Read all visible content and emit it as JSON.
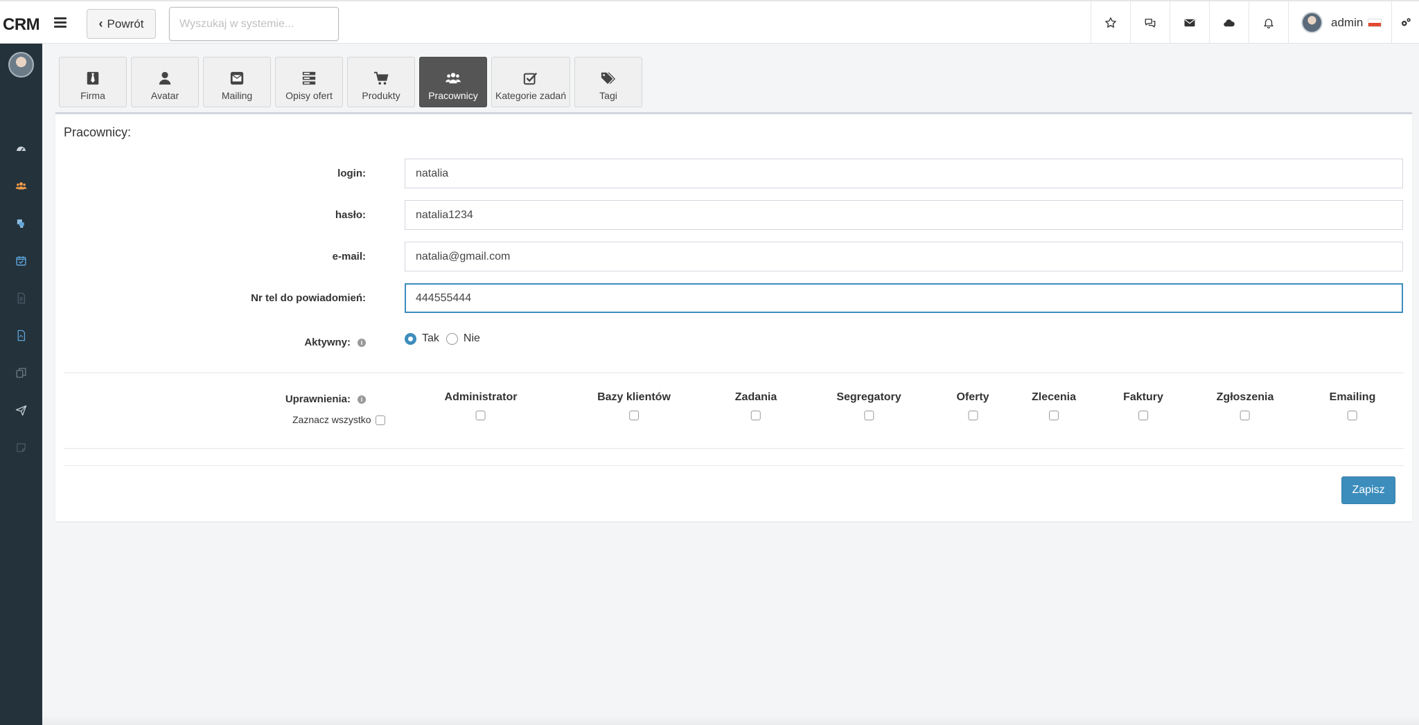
{
  "app": {
    "brand": "CRM"
  },
  "topbar": {
    "back_label": "Powrót",
    "search_placeholder": "Wyszukaj w systemie...",
    "user_name": "admin"
  },
  "tabs": [
    {
      "label": "Firma",
      "icon": "tie-icon"
    },
    {
      "label": "Avatar",
      "icon": "user-icon"
    },
    {
      "label": "Mailing",
      "icon": "envelope-icon"
    },
    {
      "label": "Opisy ofert",
      "icon": "server-icon"
    },
    {
      "label": "Produkty",
      "icon": "cart-icon"
    },
    {
      "label": "Pracownicy",
      "icon": "users-icon",
      "active": true
    },
    {
      "label": "Kategorie zadań",
      "icon": "check-square-icon"
    },
    {
      "label": "Tagi",
      "icon": "tags-icon"
    }
  ],
  "form": {
    "title": "Pracownicy:",
    "login_label": "login:",
    "login_value": "natalia",
    "password_label": "hasło:",
    "password_value": "natalia1234",
    "email_label": "e-mail:",
    "email_value": "natalia@gmail.com",
    "phone_label": "Nr tel do powiadomień:",
    "phone_value": "444555444",
    "active_label": "Aktywny:",
    "active_yes": "Tak",
    "active_no": "Nie",
    "active_selected": "Tak",
    "permissions_label": "Uprawnienia:",
    "select_all_label": "Zaznacz wszystko",
    "permissions": [
      "Administrator",
      "Bazy klientów",
      "Zadania",
      "Segregatory",
      "Oferty",
      "Zlecenia",
      "Faktury",
      "Zgłoszenia",
      "Emailing"
    ],
    "save_label": "Zapisz"
  },
  "colors": {
    "sidebar_bg": "#24323b",
    "accent": "#3c8dbc",
    "active_tab": "#555555",
    "sidebar_active_icon": "#f39c4b"
  }
}
